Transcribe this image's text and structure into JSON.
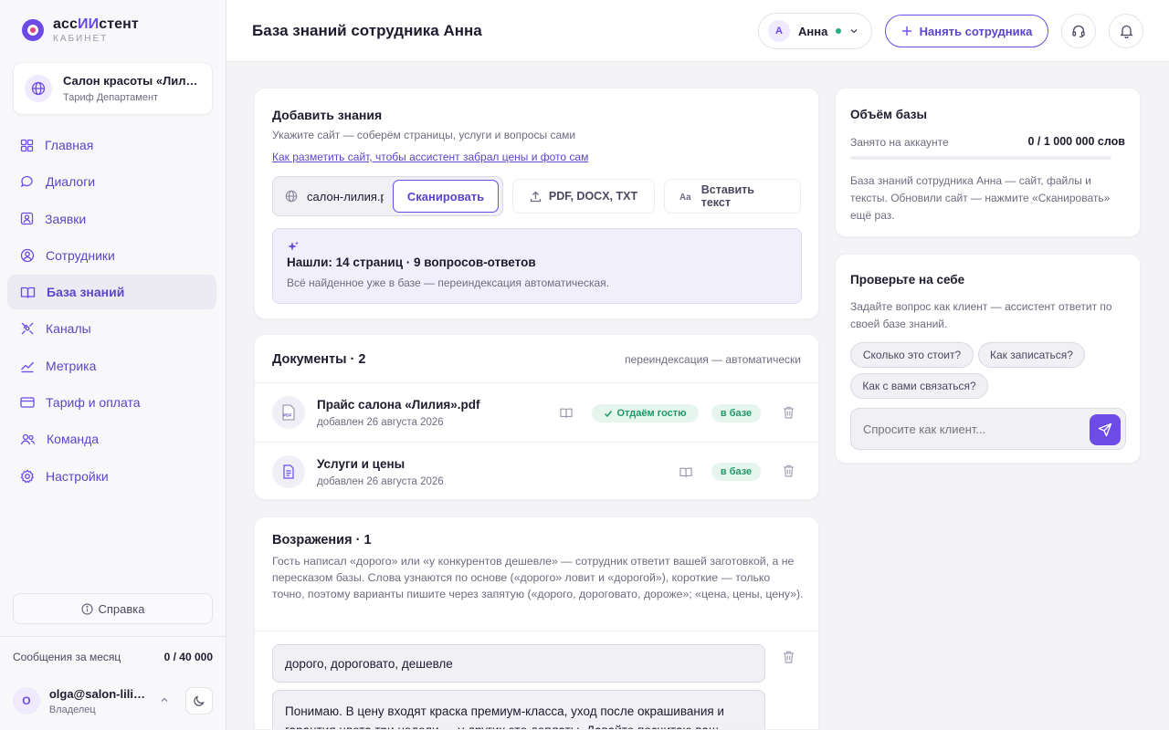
{
  "brand": {
    "name_prefix": "асс",
    "name_highlight": "ИИ",
    "name_suffix": "стент",
    "subtitle": "КАБИНЕТ"
  },
  "org": {
    "name": "Салон красоты «Лилия»",
    "plan": "Тариф Департамент"
  },
  "nav": [
    {
      "label": "Главная",
      "icon": "grid-icon"
    },
    {
      "label": "Диалоги",
      "icon": "chat-icon"
    },
    {
      "label": "Заявки",
      "icon": "inbox-icon"
    },
    {
      "label": "Сотрудники",
      "icon": "user-circle-icon"
    },
    {
      "label": "База знаний",
      "icon": "book-icon",
      "active": true
    },
    {
      "label": "Каналы",
      "icon": "satellite-icon"
    },
    {
      "label": "Метрика",
      "icon": "trend-icon"
    },
    {
      "label": "Тариф и оплата",
      "icon": "card-icon"
    },
    {
      "label": "Команда",
      "icon": "team-icon"
    },
    {
      "label": "Настройки",
      "icon": "gear-icon"
    }
  ],
  "sidebar_footer": {
    "help": "Справка",
    "quota_label": "Сообщения за месяц",
    "quota_value": "0 / 40 000",
    "user_initial": "O",
    "user_email": "olga@salon-liliya.ru",
    "user_role": "Владелец"
  },
  "header": {
    "title": "База знаний сотрудника Анна",
    "employee_initial": "А",
    "employee_name": "Анна",
    "hire_label": "Нанять сотрудника"
  },
  "add_knowledge": {
    "title": "Добавить знания",
    "subtitle": "Укажите сайт — соберём страницы, услуги и вопросы сами",
    "link": "Как разметить сайт, чтобы ассистент забрал цены и фото сам",
    "url_value": "салон-лилия.рф",
    "scan_label": "Сканировать",
    "upload_label": "PDF, DOCX, TXT",
    "paste_label": "Вставить текст",
    "found_title": "Нашли: 14 страниц · 9 вопросов-ответов",
    "found_note": "Всё найденное уже в базе — переиндексация автоматическая."
  },
  "documents": {
    "title": "Документы · 2",
    "reindex_note": "переиндексация — автоматически",
    "items": [
      {
        "name": "Прайс салона «Лилия».pdf",
        "date": "добавлен 26 августа 2026",
        "guest_badge": "Отдаём гостю",
        "status": "в базе",
        "icon": "pdf-file-icon",
        "icon_text": "PDF"
      },
      {
        "name": "Услуги и цены",
        "date": "добавлен 26 августа 2026",
        "status": "в базе",
        "icon": "text-file-icon"
      }
    ]
  },
  "objections": {
    "title": "Возражения · 1",
    "description": "Гость написал «дорого» или «у конкурентов дешевле» — сотрудник ответит вашей заготовкой, а не пересказом базы. Слова узнаются по основе («дорого» ловит и «дорогой»), короткие — только точно, поэтому варианты пишите через запятую («дорого, дороговато, дороже»; «цена, цены, цену»).",
    "items": [
      {
        "triggers": "дорого, дороговато, дешевле",
        "answer": "Понимаю. В цену входят краска премиум-класса, уход после окрашивания и гарантия цвета три недели — у других это доплаты. Давайте посчитаю ваш вариант?"
      }
    ]
  },
  "volume": {
    "title": "Объём базы",
    "used_label": "Занято на аккаунте",
    "used_value": "0 / 1 000 000 слов",
    "used_fraction": 0,
    "note": "База знаний сотрудника Анна — сайт, файлы и тексты. Обновили сайт — нажмите «Сканировать» ещё раз."
  },
  "test": {
    "title": "Проверьте на себе",
    "note": "Задайте вопрос как клиент — ассистент ответит по своей базе знаний.",
    "chips": [
      "Сколько это стоит?",
      "Как записаться?",
      "Как с вами связаться?"
    ],
    "placeholder": "Спросите как клиент..."
  },
  "colors": {
    "accent": "#6c4be6",
    "accent_text": "#5b45c8",
    "success": "#1d9a68",
    "status_dot": "#22b07d"
  }
}
